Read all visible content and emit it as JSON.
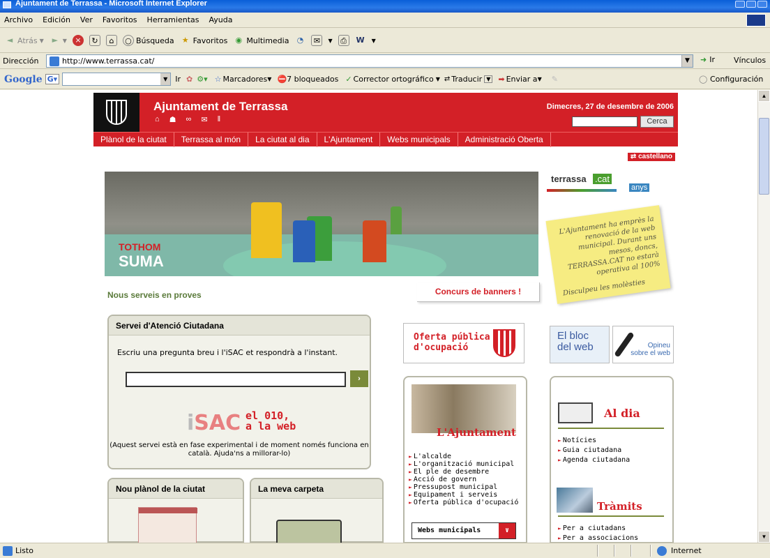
{
  "window": {
    "title": "Ajuntament de Terrassa - Microsoft Internet Explorer"
  },
  "menu": [
    "Archivo",
    "Edición",
    "Ver",
    "Favoritos",
    "Herramientas",
    "Ayuda"
  ],
  "toolbar": {
    "back": "Atrás",
    "search": "Búsqueda",
    "favorites": "Favoritos",
    "multimedia": "Multimedia"
  },
  "address": {
    "label": "Dirección",
    "url": "http://www.terrassa.cat/",
    "go": "Ir",
    "links": "Vínculos"
  },
  "google": {
    "brand": "Google",
    "ir": "Ir",
    "bookmarks": "Marcadores",
    "blocked": "7 bloqueados",
    "spell": "Corrector ortográfico",
    "translate": "Traducir",
    "send": "Enviar a",
    "settings": "Configuración"
  },
  "status": {
    "text": "Listo",
    "zone": "Internet"
  },
  "site": {
    "title": "Ajuntament de Terrassa",
    "date": "Dimecres, 27 de desembre de 2006",
    "search_button": "Cerca",
    "nav": [
      "Plànol de la ciutat",
      "Terrassa al món",
      "La ciutat al dia",
      "L'Ajuntament",
      "Webs municipals",
      "Administració Oberta"
    ],
    "language": "castellano",
    "banner": {
      "line1": "TOTHOM",
      "line2": "SUMA"
    },
    "logo10": {
      "word1": "terrassa",
      "word2": ".cat",
      "word3": "anys"
    },
    "note": {
      "text": "L'Ajuntament ha emprès la renovació de la web municipal. Durant uns mesos, doncs, TERRASSA.CAT no estarà operativa al 100%",
      "sorry": "Disculpeu les molèsties"
    },
    "services_label": "Nous serveis en proves",
    "contest": "Concurs de banners !",
    "sac": {
      "title": "Servei d'Atenció Ciutadana",
      "prompt": "Escriu una pregunta breu i l'iSAC et respondrà a l'instant.",
      "brand_i": "i",
      "brand": "SAC",
      "tag1": "el 010,",
      "tag2": "a la web",
      "note": "(Aquest servei està en fase experimental i de moment només funciona en català. Ajuda'ns a millorar-lo)"
    },
    "oferta": {
      "line1": "Oferta pública",
      "line2": "d'ocupació"
    },
    "bloc": {
      "line1": "El bloc",
      "line2": "del web"
    },
    "opineu": {
      "line1": "Opineu",
      "line2": "sobre el web"
    },
    "ajuntament": {
      "title": "L'Ajuntament",
      "links": [
        "L'alcalde",
        "L'organització municipal",
        "El ple de desembre",
        "Acció de govern",
        "Pressupost municipal",
        "Equipament i serveis",
        "Oferta pública d'ocupació"
      ],
      "select": "Webs municipals"
    },
    "aldia": {
      "title": "Al dia",
      "links": [
        "Notícies",
        "Guia ciutadana",
        "Agenda ciutadana"
      ],
      "tramits_title": "Tràmits",
      "tramits_links": [
        "Per a ciutadans",
        "Per a associacions"
      ]
    },
    "plano": {
      "title": "Nou plànol de la ciutat"
    },
    "carpeta": {
      "title": "La meva carpeta"
    }
  },
  "colors": {
    "accent": "#d32027",
    "olive": "#7a8a3a"
  }
}
